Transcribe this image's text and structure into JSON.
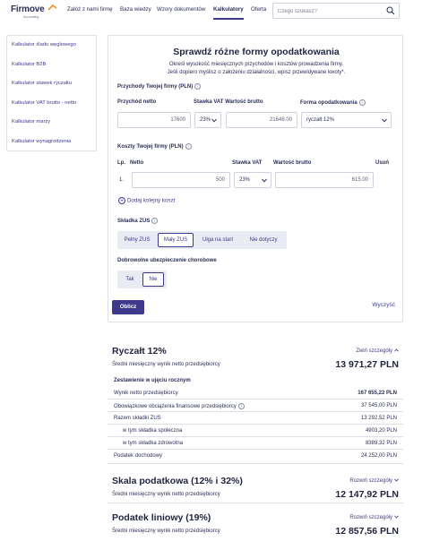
{
  "header": {
    "logo_text": "Firmove",
    "logo_sub": "Accounting",
    "nav": [
      "Załóż z nami firmę",
      "Baza wiedzy",
      "Wzory dokumentów",
      "Kalkulatory",
      "Oferta"
    ],
    "search_placeholder": "Czego szukasz?"
  },
  "sidebar": {
    "items": [
      "Kalkulator śladu węglowego",
      "Kalkulator B2B",
      "Kalkulator stawek ryczałtu",
      "Kalkulator VAT brutto - netto",
      "Kalkulator marży",
      "Kalkulator wynagrodzenia"
    ]
  },
  "form": {
    "title": "Sprawdź różne formy opodatkowania",
    "intro_line1": "Określ wysokość miesięcznych przychodów i kosztów prowadzenia firmy.",
    "intro_line2": "Jeśli dopiero myślisz o założeniu działalności, wpisz przewidywane kwoty*.",
    "revenue_section": "Przychody Twojej firmy (PLN)",
    "col_net_revenue": "Przychód netto",
    "col_vat_gross": "Stawka VAT Wartość brutto",
    "col_tax_form": "Forma opodatkowania",
    "revenue_net": "17600",
    "revenue_vat": "23%",
    "revenue_gross": "21648.00",
    "tax_form": "ryczałt 12%",
    "costs_section": "Koszty Twojej firmy (PLN)",
    "col_lp": "Lp.",
    "col_net": "Netto",
    "col_vat": "Stawka VAT",
    "col_gross": "Wartość brutto",
    "col_delete": "Usuń",
    "cost_lp": "1.",
    "cost_net": "500",
    "cost_vat": "23%",
    "cost_gross": "615.00",
    "add_cost": "Dodaj kolejny koszt",
    "zus_label": "Składka ZUS",
    "zus_options": [
      "Pełny ZUS",
      "Mały ZUS",
      "Ulga na start",
      "Nie dotyczy"
    ],
    "sickness_label": "Dobrowolne ubezpieczenie chorobowe",
    "sickness_options": [
      "Tak",
      "Nie"
    ],
    "calc_button": "Oblicz",
    "clear_button": "Wyczyść"
  },
  "results": {
    "r1_title": "Ryczałt 12%",
    "r1_toggle": "Zwiń szczegóły",
    "r1_sub": "Średni miesięczny wynik netto przedsiębiorcy",
    "r1_value": "13 971,27 PLN",
    "summary_title": "Zestawienie w ujęciu rocznym",
    "rows": [
      {
        "label": "Wynik netto przedsiębiorcy",
        "value": "167 655,22 PLN"
      },
      {
        "label": "Obowiązkowe obciążenia finansowe przedsiębiorcy",
        "value": "37 545,00 PLN"
      },
      {
        "label": "Razem składki ZUS",
        "value": "13 292,52 PLN"
      },
      {
        "label": "w tym składka społeczna",
        "value": "4903,20 PLN"
      },
      {
        "label": "w tym składka zdrowotna",
        "value": "8389,32 PLN"
      },
      {
        "label": "Podatek dochodowy",
        "value": "24 252,00 PLN"
      }
    ],
    "r2_title": "Skala podatkowa (12% i 32%)",
    "r2_toggle": "Rozwiń szczegóły",
    "r2_sub": "Średni miesięczny wynik netto przedsiębiorcy",
    "r2_value": "12 147,92 PLN",
    "r3_title": "Podatek liniowy (19%)",
    "r3_toggle": "Rozwiń szczegóły",
    "r3_sub": "Średni miesięczny wynik netto przedsiębiorcy",
    "r3_value": "12 857,56 PLN"
  }
}
